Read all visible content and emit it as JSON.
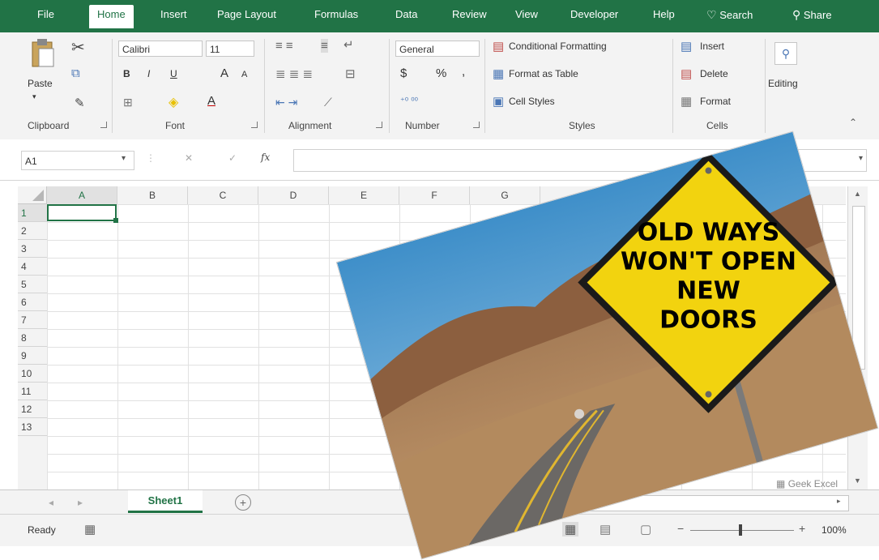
{
  "ribbon_tabs": {
    "file": "File",
    "home": "Home",
    "insert": "Insert",
    "page_layout": "Page Layout",
    "formulas": "Formulas",
    "data": "Data",
    "review": "Review",
    "view": "View",
    "developer": "Developer",
    "help": "Help",
    "search": "Search",
    "share": "Share"
  },
  "clipboard": {
    "paste": "Paste",
    "label": "Clipboard"
  },
  "font": {
    "name": "Calibri",
    "size": "11",
    "bold": "B",
    "italic": "I",
    "underline": "U",
    "grow": "A",
    "shrink": "A",
    "color_letter": "A",
    "label": "Font"
  },
  "alignment": {
    "label": "Alignment"
  },
  "number": {
    "format": "General",
    "currency": "$",
    "percent": "%",
    "comma": ",",
    "label": "Number"
  },
  "styles": {
    "conditional": "Conditional Formatting",
    "format_table": "Format as Table",
    "cell_styles": "Cell Styles",
    "label": "Styles"
  },
  "cells": {
    "insert": "Insert",
    "delete": "Delete",
    "format": "Format",
    "label": "Cells"
  },
  "editing": {
    "label": "Editing"
  },
  "formula_bar": {
    "name_box": "A1",
    "fx": "fx",
    "cancel": "✕",
    "enter": "✓"
  },
  "columns": [
    "A",
    "B",
    "C",
    "D",
    "E",
    "F",
    "G"
  ],
  "rows": [
    "1",
    "2",
    "3",
    "4",
    "5",
    "6",
    "7",
    "8",
    "9",
    "10",
    "11",
    "12",
    "13"
  ],
  "sheet": {
    "tab": "Sheet1",
    "add": "+"
  },
  "watermark": "Geek Excel",
  "status": {
    "ready": "Ready",
    "zoom": "100%"
  },
  "sign": {
    "line1": "OLD WAYS",
    "line2": "WON'T OPEN",
    "line3": "NEW",
    "line4": "DOORS"
  },
  "colors": {
    "brand": "#217346",
    "ribbon": "#f3f3f3",
    "sign": "#f2d30f"
  }
}
